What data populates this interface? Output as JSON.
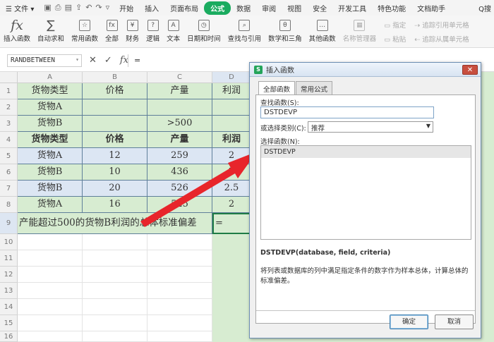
{
  "menu": {
    "file": "文件",
    "tabs": [
      "开始",
      "插入",
      "页面布局",
      "公式",
      "数据",
      "审阅",
      "视图",
      "安全",
      "开发工具",
      "特色功能",
      "文档助手"
    ],
    "active_tab": "公式",
    "search": "Q搜"
  },
  "ribbon": {
    "buttons": [
      "插入函数",
      "自动求和",
      "常用函数",
      "全部",
      "财务",
      "逻辑",
      "文本",
      "日期和时间",
      "查找与引用",
      "数学和三角",
      "其他函数",
      "名称管理器"
    ],
    "group_a": [
      "指定",
      "粘贴"
    ],
    "group_b": [
      "追踪引用单元格",
      "追踪从属单元格"
    ]
  },
  "formula_bar": {
    "name_box": "RANDBETWEEN",
    "cancel": "✕",
    "confirm": "✓",
    "fx": "fx",
    "value": "="
  },
  "columns": [
    "A",
    "B",
    "C",
    "D"
  ],
  "rows": [
    "1",
    "2",
    "3",
    "4",
    "5",
    "6",
    "7",
    "8",
    "9",
    "10",
    "11",
    "12",
    "13",
    "14",
    "15",
    "16"
  ],
  "table": {
    "r1": [
      "货物类型",
      "价格",
      "产量",
      "利润"
    ],
    "r2": [
      "货物A",
      "",
      "",
      ""
    ],
    "r3": [
      "货物B",
      "",
      ">500",
      ""
    ],
    "r4": [
      "货物类型",
      "价格",
      "产量",
      "利润"
    ],
    "r5": [
      "货物A",
      "12",
      "259",
      "2"
    ],
    "r6": [
      "货物B",
      "10",
      "436",
      "2"
    ],
    "r7": [
      "货物B",
      "20",
      "526",
      "2.5"
    ],
    "r8": [
      "货物A",
      "16",
      "525",
      "2"
    ],
    "r9_label": "产能超过500的货物B利润的总体标准偏差",
    "r9_value": "="
  },
  "dialog": {
    "title": "插入函数",
    "close": "✕",
    "tabs": [
      "全部函数",
      "常用公式"
    ],
    "search_label": "查找函数(S):",
    "search_value": "DSTDEVP",
    "category_label": "或选择类别(C):",
    "category_value": "推荐",
    "list_label": "选择函数(N):",
    "list_items": [
      "DSTDEVP"
    ],
    "signature": "DSTDEVP(database, field, criteria)",
    "description": "将列表或数据库的列中满足指定条件的数字作为样本总体，计算总体的标准偏差。",
    "ok": "确定",
    "cancel": "取消"
  },
  "colors": {
    "accent": "#1aab5f",
    "header_green": "#d7ecd1",
    "row_blue": "#dce6f3",
    "arrow": "#e8252b"
  }
}
